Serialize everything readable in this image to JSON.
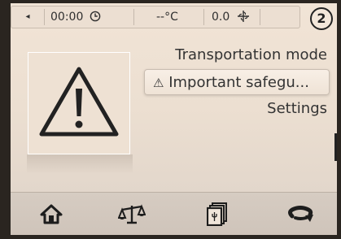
{
  "status_bar": {
    "back_symbol": "◂",
    "time": "00:00",
    "temperature": "--°C",
    "fan_value": "0.0"
  },
  "page_badge": "2",
  "menu": {
    "items": [
      {
        "label": "Transportation mode",
        "selected": false,
        "icon": ""
      },
      {
        "label": "Important safegu...",
        "selected": true,
        "icon": "warning-icon"
      },
      {
        "label": "Settings",
        "selected": false,
        "icon": ""
      }
    ]
  },
  "warning_symbol": "⚠",
  "bottom_bar": {
    "icons": [
      "home-icon",
      "scale-icon",
      "recipe-book-icon",
      "rotate-icon"
    ]
  },
  "colors": {
    "background": "#ecdfd1",
    "text": "#333333",
    "bottom_bar": "#d2c7bd"
  }
}
